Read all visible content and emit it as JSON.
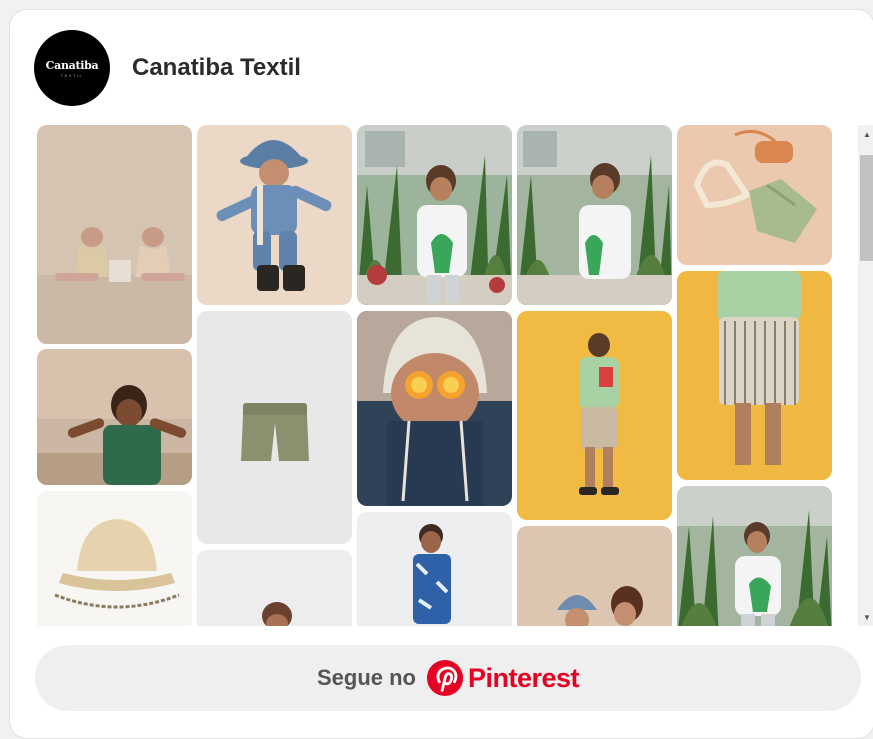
{
  "profile": {
    "name": "Canatiba Textil",
    "avatar_text": "Canatiba",
    "avatar_subtext": "TEXTIL"
  },
  "follow": {
    "prefix": "Segue no",
    "brand": "Pinterest"
  },
  "pins": [
    {
      "subject": "two children in pastel outfits sitting on beige backdrop"
    },
    {
      "subject": "child in blue bucket hat and denim outfit crouching"
    },
    {
      "subject": "boy in white graphic t-shirt among tropical plants"
    },
    {
      "subject": "boy in white graphic t-shirt among tropical plants (second shot)"
    },
    {
      "subject": "folded green shirt with orange bag on peach background"
    },
    {
      "subject": "child shading eyes on beach at sunset"
    },
    {
      "subject": "olive green shorts on light grey background"
    },
    {
      "subject": "child with orange glasses and white bucket hat"
    },
    {
      "subject": "boy from behind in light green shirt on yellow background"
    },
    {
      "subject": "child in striped shorts and green shirt on yellow background"
    },
    {
      "subject": "cream bucket hat with chain strap"
    },
    {
      "subject": "child partially visible on light grey background"
    },
    {
      "subject": "boy in blue patterned shirt on white background"
    },
    {
      "subject": "two children with bucket hats on beige background"
    },
    {
      "subject": "child in white graphic t-shirt among tropical plants"
    }
  ],
  "colors": {
    "pinterest_red": "#e60023",
    "follow_bg": "#efefef",
    "scroll_thumb": "#c1c1c1"
  }
}
